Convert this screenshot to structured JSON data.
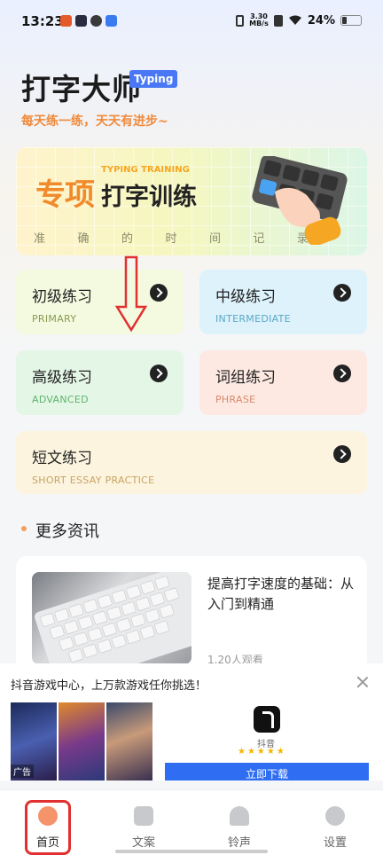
{
  "status_bar": {
    "time": "13:23",
    "net_speed_value": "3.30",
    "net_speed_unit": "MB/s",
    "battery_percent": "24%"
  },
  "header": {
    "title": "打字大师",
    "badge": "Typing",
    "subtitle": "每天练一练，天天有进步~"
  },
  "banner": {
    "title_accent": "专项",
    "title_en": "TYPING TRAINING",
    "title_main": "打字训练",
    "chars": [
      "准",
      "确",
      "的",
      "时",
      "间",
      "记",
      "录"
    ]
  },
  "practice": [
    {
      "zh": "初级练习",
      "en": "PRIMARY"
    },
    {
      "zh": "中级练习",
      "en": "INTERMEDIATE"
    },
    {
      "zh": "高级练习",
      "en": "ADVANCED"
    },
    {
      "zh": "词组练习",
      "en": "PHRASE"
    },
    {
      "zh": "短文练习",
      "en": "SHORT ESSAY PRACTICE"
    }
  ],
  "section": {
    "title": "更多资讯"
  },
  "news": {
    "title": "提高打字速度的基础：从入门到精通",
    "views": "1.20人观看"
  },
  "ad": {
    "title": "抖音游戏中心，上万款游戏任你挑选！",
    "label": "广告",
    "app_name": "抖音",
    "stars": "★★★★★",
    "button": "立即下载"
  },
  "nav": {
    "items": [
      {
        "label": "首页",
        "icon": "home-grid-icon"
      },
      {
        "label": "文案",
        "icon": "document-icon"
      },
      {
        "label": "铃声",
        "icon": "bell-icon"
      },
      {
        "label": "设置",
        "icon": "gear-icon"
      }
    ]
  },
  "colors": {
    "accent_orange": "#f08a3c",
    "badge_blue": "#4a78f5",
    "annotation_red": "#e03030"
  }
}
